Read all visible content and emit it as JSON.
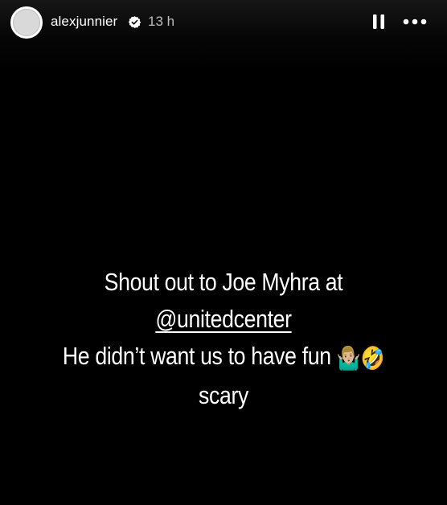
{
  "header": {
    "username": "alexjunnier",
    "verified_icon": "verified-badge-icon",
    "timestamp": "13 h",
    "pause_icon": "pause-icon",
    "more_icon": "more-options-icon"
  },
  "story": {
    "background_color": "#000000",
    "text_color": "#ffffff",
    "line1": "Shout out to Joe Myhra at",
    "mention": "@unitedcenter",
    "line3": "He didn’t want us to have fun",
    "emoji1": "🤷🏼‍♂️",
    "emoji2": "🤣",
    "line4": "scary"
  }
}
